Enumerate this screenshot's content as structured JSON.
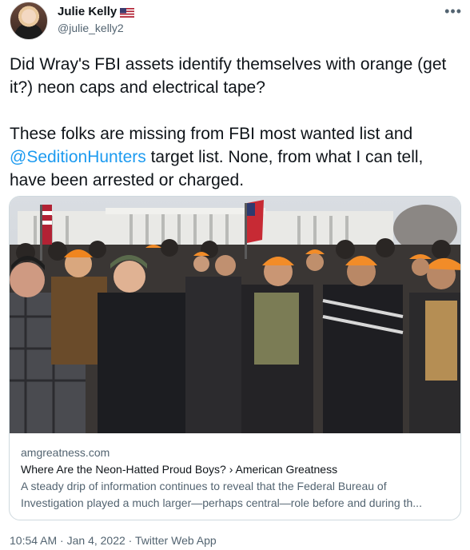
{
  "author": {
    "name": "Julie Kelly",
    "badge": "us-flag-icon",
    "handle": "@julie_kelly2"
  },
  "tweet": {
    "paragraph1": "Did Wray's FBI assets identify themselves with orange (get it?) neon caps and electrical tape?",
    "paragraph2_before": "These folks are missing from FBI most wanted list and ",
    "paragraph2_mention": "@SeditionHunters",
    "paragraph2_after": " target list. None, from what I can tell, have been arrested or charged."
  },
  "card": {
    "domain": "amgreatness.com",
    "title": "Where Are the Neon-Hatted Proud Boys? › American Greatness",
    "description": "A steady drip of information continues to reveal that the Federal Bureau of Investigation played a much larger—perhaps central—role before and during th..."
  },
  "footer": {
    "time": "10:54 AM",
    "date": "Jan 4, 2022",
    "source": "Twitter Web App",
    "separator": " · "
  },
  "colors": {
    "text": "#0f1419",
    "secondary": "#536471",
    "link": "#1d9bf0",
    "border": "#cfd9de",
    "cap_orange": "#f28c28"
  }
}
